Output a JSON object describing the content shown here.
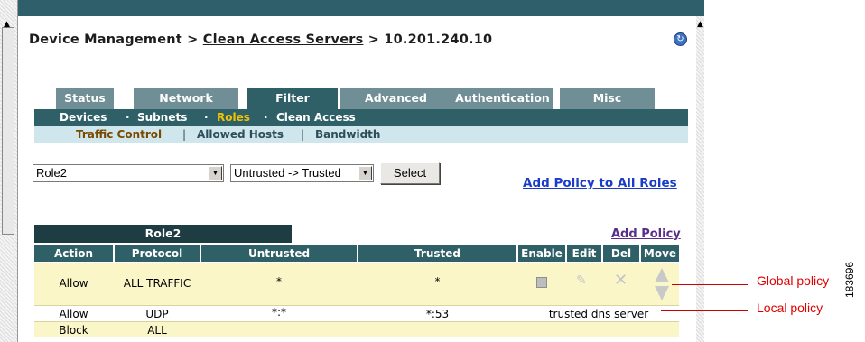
{
  "breadcrumb": {
    "root": "Device Management",
    "sep1": " > ",
    "link": "Clean Access Servers",
    "sep2": " > ",
    "current": "10.201.240.10"
  },
  "tabs": [
    "Status",
    "Network",
    "Filter",
    "Advanced",
    "Authentication",
    "Misc"
  ],
  "active_tab": "Filter",
  "subnav": {
    "items": [
      "Devices",
      "Subnets",
      "Roles",
      "Clean Access"
    ],
    "active": "Roles",
    "separator": "·"
  },
  "subnav2": {
    "items": [
      "Traffic Control",
      "Allowed Hosts",
      "Bandwidth"
    ],
    "active": "Traffic Control",
    "separator": "|"
  },
  "controls": {
    "role_select": "Role2",
    "direction_select": "Untrusted -> Trusted",
    "select_button": "Select",
    "add_policy_all": "Add Policy to All Roles",
    "add_policy": "Add Policy"
  },
  "table": {
    "role_title": "Role2",
    "headers": [
      "Action",
      "Protocol",
      "Untrusted",
      "Trusted",
      "Enable",
      "Edit",
      "Del",
      "Move"
    ],
    "rows": [
      {
        "action": "Allow",
        "protocol": "ALL TRAFFIC",
        "untrusted": "*",
        "trusted": "*",
        "enabled": false
      },
      {
        "action": "Allow",
        "protocol": "UDP",
        "untrusted": "*:*",
        "trusted": "*:53",
        "description": "trusted dns server"
      },
      {
        "action": "Block",
        "protocol": "ALL"
      }
    ]
  },
  "callouts": {
    "global": "Global policy",
    "local": "Local policy"
  },
  "figure_number": "183696",
  "icons": {
    "refresh": "refresh-icon",
    "edit": "edit-icon",
    "delete": "delete-icon",
    "move": "move-arrows-icon"
  },
  "colors": {
    "tab": "#6f8e96",
    "tab_active": "#2f6068",
    "subnav": "#2f6068",
    "subnav_active": "#f0c400",
    "row_highlight": "#fbf6c8",
    "callout": "#e00000",
    "link": "#1a3cc7"
  }
}
